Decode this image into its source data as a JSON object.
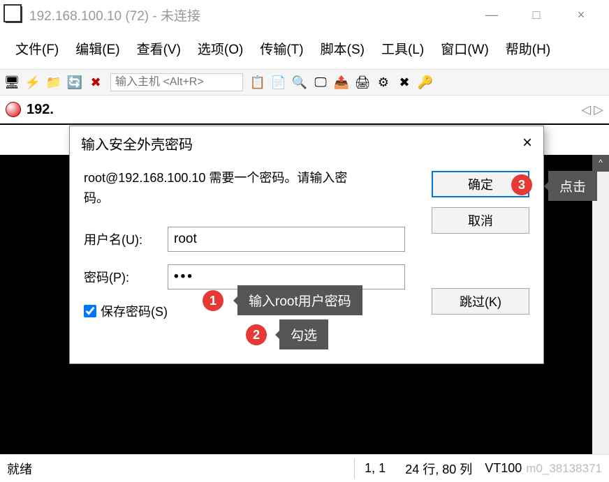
{
  "window": {
    "title": "192.168.100.10 (72) - 未连接",
    "minimize": "—",
    "maximize": "□",
    "close": "×"
  },
  "menu": {
    "file": "文件(F)",
    "edit": "编辑(E)",
    "view": "查看(V)",
    "options": "选项(O)",
    "transfer": "传输(T)",
    "script": "脚本(S)",
    "tools": "工具(L)",
    "window": "窗口(W)",
    "help": "帮助(H)"
  },
  "toolbar": {
    "host_placeholder": "输入主机 <Alt+R>"
  },
  "tab": {
    "label": "192."
  },
  "status": {
    "ready": "就绪",
    "pos": "1, 1",
    "size": "24 行, 80 列",
    "term": "VT100",
    "watermark": "m0_38138371"
  },
  "dialog": {
    "title": "输入安全外壳密码",
    "message": "root@192.168.100.10 需要一个密码。请输入密码。",
    "user_label": "用户名(U):",
    "user_value": "root",
    "pass_label": "密码(P):",
    "pass_value": "•••",
    "save_label": "保存密码(S)",
    "ok": "确定",
    "cancel": "取消",
    "skip": "跳过(K)",
    "close": "×"
  },
  "annotations": {
    "step1": "1",
    "step1_text": "输入root用户密码",
    "step2": "2",
    "step2_text": "勾选",
    "step3": "3",
    "step3_text": "点击"
  }
}
